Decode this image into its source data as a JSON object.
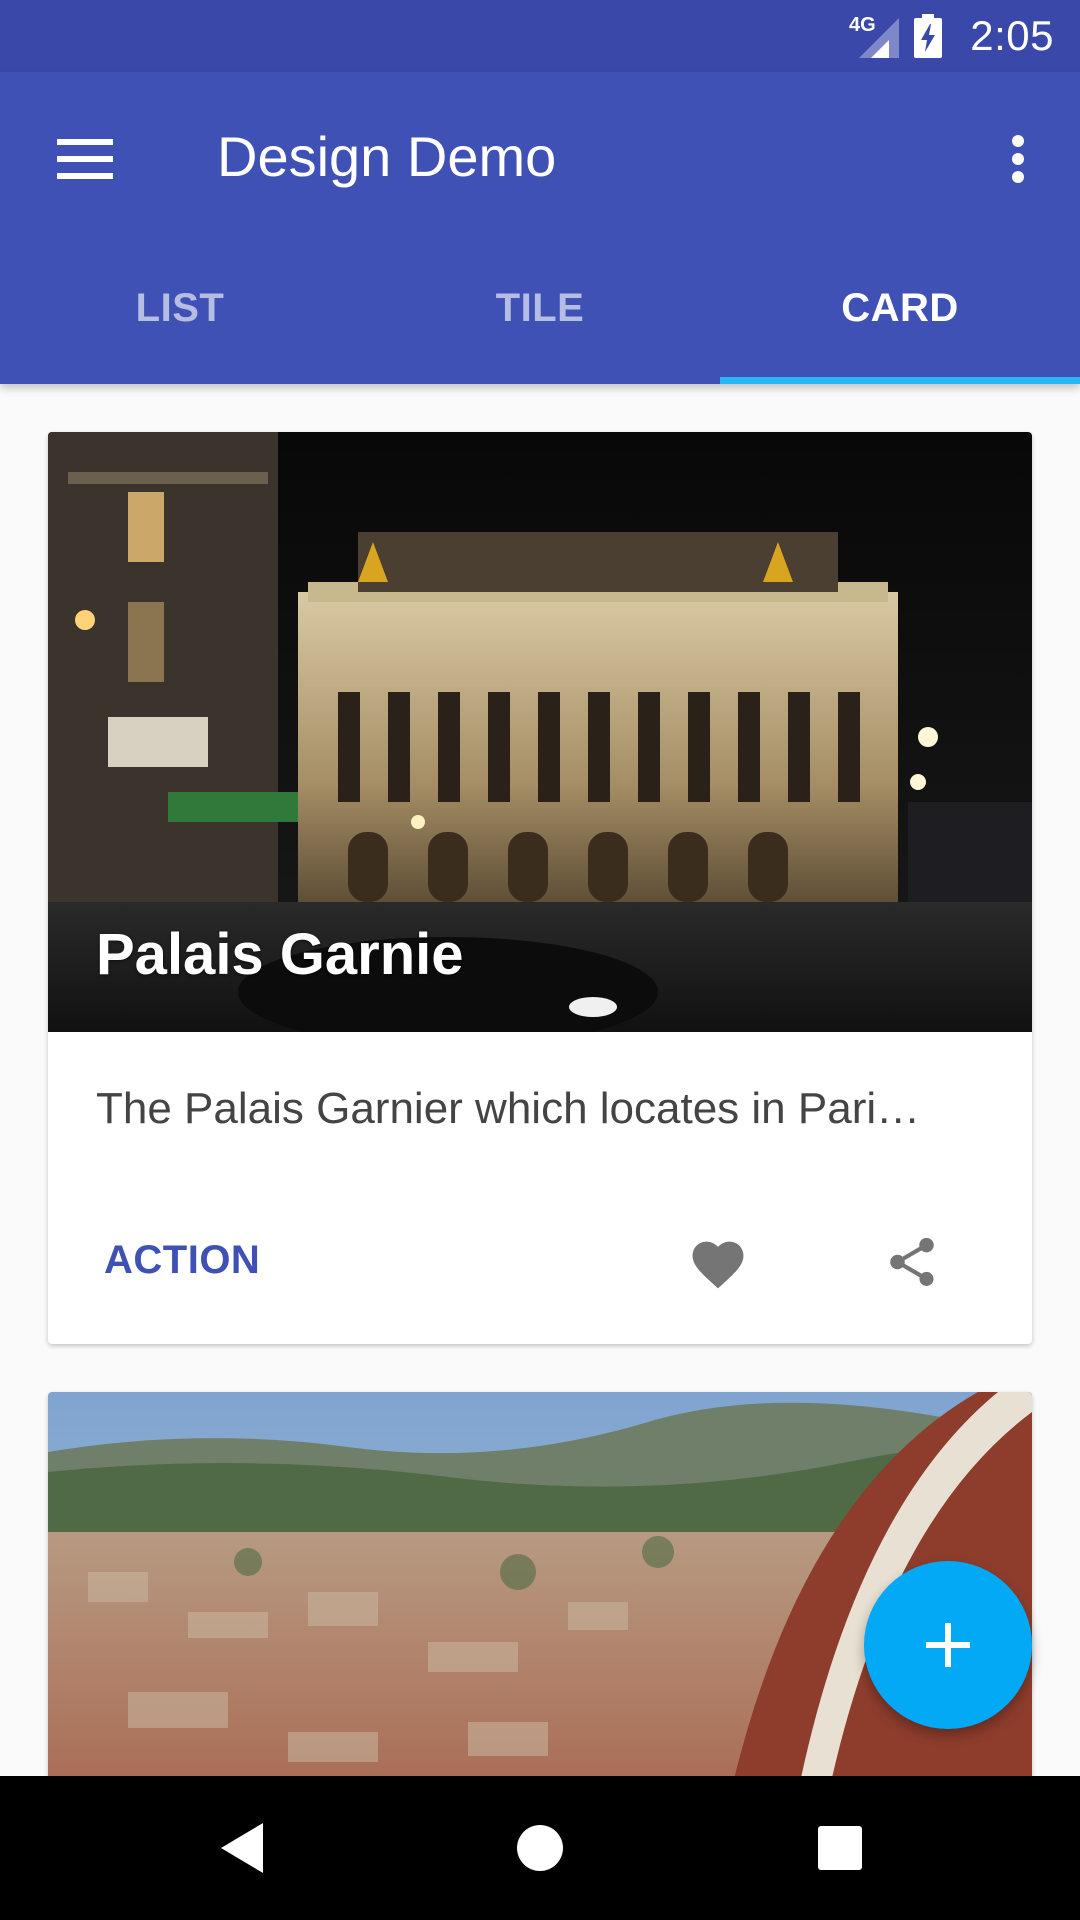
{
  "status_bar": {
    "network": "4G",
    "time": "2:05",
    "icons": [
      "signal-icon",
      "battery-charging-icon"
    ]
  },
  "app_bar": {
    "title": "Design Demo",
    "icons": [
      "menu-icon",
      "more-vert-icon"
    ],
    "background": "#3F51B5"
  },
  "tabs": [
    {
      "label": "LIST",
      "active": false
    },
    {
      "label": "TILE",
      "active": false
    },
    {
      "label": "CARD",
      "active": true
    }
  ],
  "tab_indicator_color": "#29B6F6",
  "cards": [
    {
      "title": "Palais Garnie",
      "description": "The Palais Garnier which locates in Pari…",
      "action_label": "ACTION",
      "icons": [
        "favorite-icon",
        "share-icon"
      ]
    },
    {
      "title": "",
      "icons": []
    }
  ],
  "fab": {
    "icon": "add-icon",
    "color": "#03A9F4"
  },
  "nav_bar": {
    "icons": [
      "back-icon",
      "home-icon",
      "recents-icon"
    ]
  }
}
